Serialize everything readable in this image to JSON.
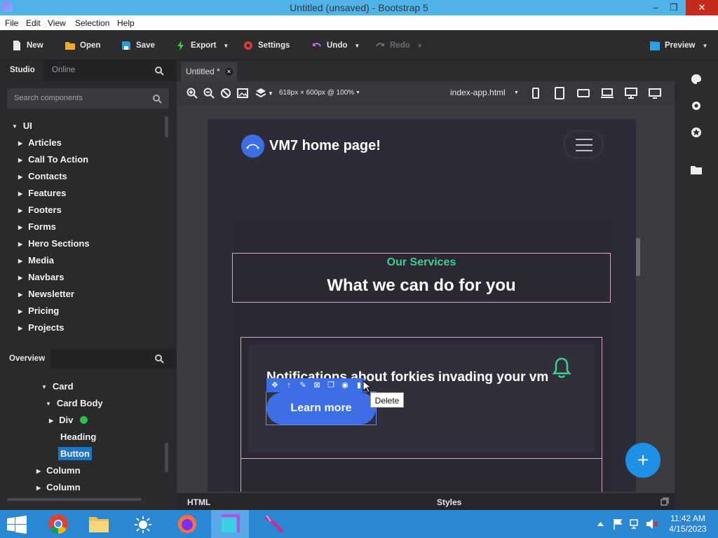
{
  "window": {
    "title": "Untitled (unsaved) - Bootstrap 5",
    "minimize": "–",
    "maximize": "❐",
    "close": "✕"
  },
  "menu": [
    "File",
    "Edit",
    "View",
    "Selection",
    "Help"
  ],
  "toolbar": {
    "new": "New",
    "open": "Open",
    "save": "Save",
    "export": "Export",
    "settings": "Settings",
    "undo": "Undo",
    "redo": "Redo",
    "preview": "Preview"
  },
  "left_panel": {
    "tabs": [
      "Studio",
      "Online"
    ],
    "search_placeholder": "Search components",
    "tree_root": "UI",
    "components": [
      "Articles",
      "Call To Action",
      "Contacts",
      "Features",
      "Footers",
      "Forms",
      "Hero Sections",
      "Media",
      "Navbars",
      "Newsletter",
      "Pricing",
      "Projects"
    ],
    "overview_title": "Overview",
    "overview_items": [
      "Card",
      "Card Body",
      "Div",
      "Heading",
      "Button",
      "Column",
      "Column"
    ]
  },
  "editor": {
    "tab_title": "Untitled *",
    "size_label": "618px × 600px @ 100%",
    "file_select": "index-app.html",
    "bottom_html": "HTML",
    "bottom_styles": "Styles"
  },
  "page": {
    "brand": "VM7 home page!",
    "eyebrow": "Our Services",
    "heading": "What we can do for you",
    "card_title": "Notifications about forkies invading your vm",
    "button": "Learn more",
    "tooltip": "Delete"
  },
  "fab": "+",
  "taskbar": {
    "time": "11:42 AM",
    "date": "4/15/2023"
  },
  "colors": {
    "accent": "#3c6ee5",
    "green": "#3ecf8e",
    "selection_outline": "#d4a8d1",
    "titlebar": "#4fb3e8"
  }
}
